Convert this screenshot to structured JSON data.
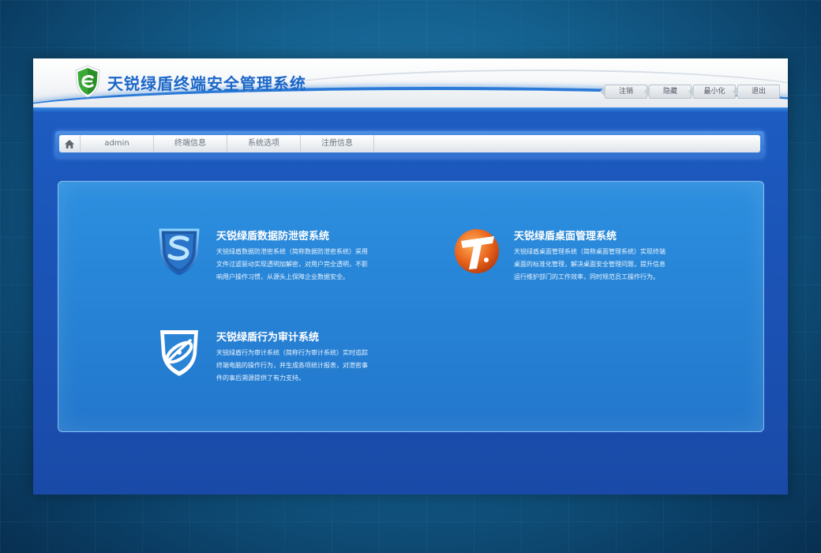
{
  "app": {
    "title": "天锐绿盾终端安全管理系统"
  },
  "window_controls": [
    {
      "label": "注销"
    },
    {
      "label": "隐藏"
    },
    {
      "label": "最小化"
    },
    {
      "label": "退出"
    }
  ],
  "nav": {
    "home_icon": "home-icon",
    "items": [
      {
        "label": "admin"
      },
      {
        "label": "终端信息"
      },
      {
        "label": "系统选项"
      },
      {
        "label": "注册信息"
      }
    ]
  },
  "products": [
    {
      "title": "天锐绿盾数据防泄密系统",
      "description": "天锐绿盾数据防泄密系统（简称数据防泄密系统）采用文件过滤驱动实现透明加解密，对用户完全透明，不影响用户操作习惯，从源头上保障企业数据安全。",
      "icon": "shield-s-icon"
    },
    {
      "title": "天锐绿盾桌面管理系统",
      "description": "天锐绿盾桌面管理系统（简称桌面管理系统）实现终端桌面的标准化管理，解决桌面安全管理问题，提升信息运行维护部门的工作效率，同时规范员工操作行为。",
      "icon": "orange-t-icon"
    },
    {
      "title": "天锐绿盾行为审计系统",
      "description": "天锐绿盾行为审计系统（简称行为审计系统）实时追踪终端电脑的操作行为，并生成各项统计报表，对泄密事件的事后溯源提供了有力支持。",
      "icon": "shield-orbit-icon"
    }
  ],
  "colors": {
    "title_blue": "#1b67c9",
    "window_blue": "#1f5fc6",
    "panel_blue": "#2784d6",
    "logo_green": "#3aa935",
    "accent_orange": "#e8641c"
  }
}
